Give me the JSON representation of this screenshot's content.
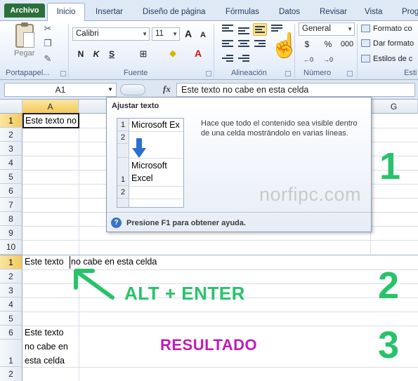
{
  "ribbon": {
    "tabs": [
      "Archivo",
      "Inicio",
      "Insertar",
      "Diseño de página",
      "Fórmulas",
      "Datos",
      "Revisar",
      "Vista",
      "Prog"
    ],
    "clipboard": {
      "paste_label": "Pegar",
      "group_label": "Portapapel..."
    },
    "font": {
      "name": "Calibri",
      "size": "11",
      "group_label": "Fuente",
      "bold": "N",
      "italic": "K",
      "underline": "S",
      "grow": "A",
      "shrink": "A"
    },
    "alignment": {
      "group_label": "Alineación"
    },
    "number": {
      "format": "General",
      "currency": "$",
      "percent": "%",
      "thousands": "000",
      "group_label": "Número"
    },
    "styles": {
      "items": [
        "Formato co",
        "Dar formato",
        "Estilos de c"
      ],
      "group_label": "Esti"
    }
  },
  "formula_bar": {
    "name_box": "A1",
    "fx": "fx",
    "content": "Este texto no cabe en esta celda"
  },
  "sheet": {
    "columns": [
      "A",
      "G"
    ],
    "rows_top": [
      "1",
      "2",
      "3",
      "4",
      "5",
      "6",
      "7",
      "8",
      "9",
      "10"
    ],
    "rows_bottom": [
      "1",
      "2",
      "3",
      "4",
      "5",
      "6",
      "1",
      "2"
    ],
    "cell_truncated": "Este texto no",
    "cell_full_left": "Este texto",
    "cell_full_right": "no cabe en esta celda",
    "cell_wrapped": [
      "Este texto",
      "no cabe en",
      "esta celda"
    ]
  },
  "tooltip": {
    "title": "Ajustar texto",
    "description": "Hace que todo el contenido sea visible dentro de una celda mostrándolo en varias líneas.",
    "demo_before": "Microsoft Ex",
    "demo_after": [
      "Microsoft",
      "Excel"
    ],
    "demo_rows": [
      "1",
      "2",
      "1",
      "2"
    ],
    "help": "Presione F1 para obtener ayuda."
  },
  "overlay": {
    "watermark": "norfipc.com",
    "step1": "1",
    "step2": "2",
    "step3": "3",
    "shortcut": "ALT + ENTER",
    "result": "RESULTADO",
    "accent_green": "#27c36a",
    "accent_purple": "#c21bb4"
  }
}
